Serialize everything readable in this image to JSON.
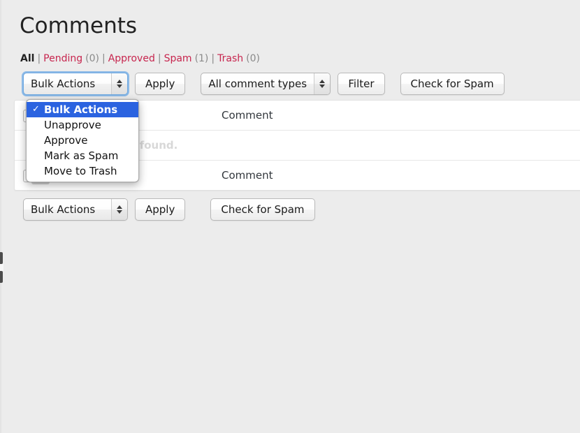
{
  "page": {
    "title": "Comments",
    "background_color": "#ececec"
  },
  "filters": {
    "separator": "|",
    "links": [
      {
        "label": "All",
        "count": "",
        "current": true,
        "color": "#222222"
      },
      {
        "label": "Pending",
        "count": "(0)",
        "current": false,
        "color": "#c7254e"
      },
      {
        "label": "Approved",
        "count": "",
        "current": false,
        "color": "#c7254e"
      },
      {
        "label": "Spam",
        "count": "(1)",
        "current": false,
        "color": "#c7254e"
      },
      {
        "label": "Trash",
        "count": "(0)",
        "current": false,
        "color": "#c7254e"
      }
    ]
  },
  "toolbar_top": {
    "bulk_select_value": "Bulk Actions",
    "apply_label": "Apply",
    "types_select_value": "All comment types",
    "filter_label": "Filter",
    "check_spam_label": "Check for Spam"
  },
  "toolbar_bottom": {
    "bulk_select_value": "Bulk Actions",
    "apply_label": "Apply",
    "check_spam_label": "Check for Spam"
  },
  "dropdown": {
    "open": true,
    "check_glyph": "✓",
    "highlight_color": "#2b63e0",
    "items": [
      {
        "label": "Bulk Actions",
        "selected": true
      },
      {
        "label": "Unapprove",
        "selected": false
      },
      {
        "label": "Approve",
        "selected": false
      },
      {
        "label": "Mark as Spam",
        "selected": false
      },
      {
        "label": "Move to Trash",
        "selected": false
      }
    ]
  },
  "table": {
    "header_comment": "Comment",
    "footer_comment": "Comment",
    "empty_message": "No comments found.",
    "rows": [
      {
        "kind": "header",
        "comment": "Comment"
      },
      {
        "kind": "empty",
        "comment": ""
      },
      {
        "kind": "footer",
        "comment": "Comment"
      }
    ]
  }
}
